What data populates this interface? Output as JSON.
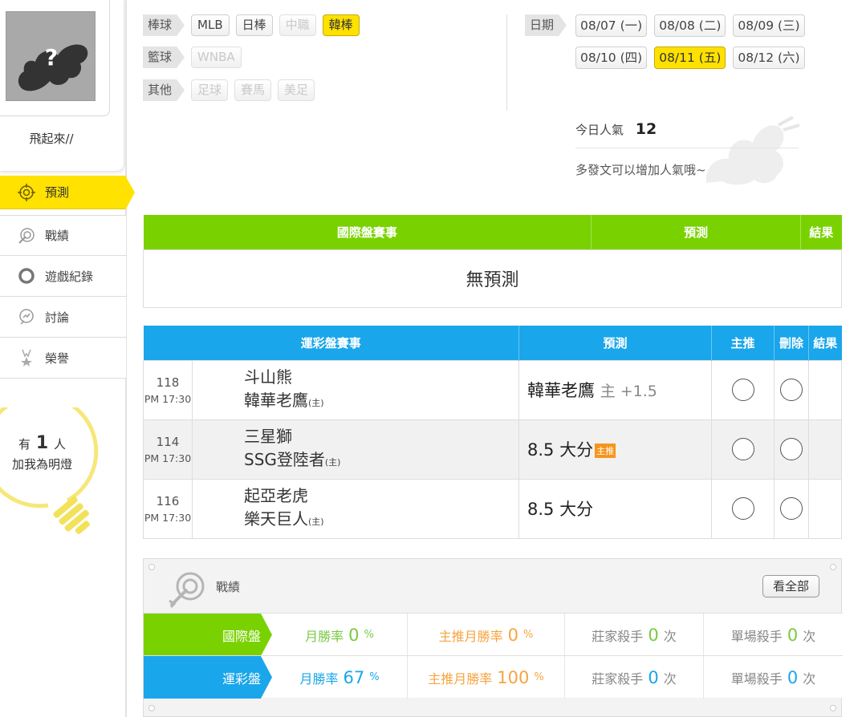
{
  "user": {
    "name": "飛起來//"
  },
  "nav": [
    {
      "label": "預測",
      "icon": "target-icon",
      "active": true
    },
    {
      "label": "戰績",
      "icon": "record-target-icon",
      "active": false
    },
    {
      "label": "遊戲紀錄",
      "icon": "ring-icon",
      "active": false
    },
    {
      "label": "討論",
      "icon": "discussion-icon",
      "active": false
    },
    {
      "label": "榮譽",
      "icon": "medal-icon",
      "active": false
    }
  ],
  "fans": {
    "prefix": "有",
    "count": "1",
    "suffix": "人",
    "line2": "加我為明燈"
  },
  "filters": {
    "baseball": {
      "label": "棒球",
      "items": [
        {
          "label": "MLB",
          "state": "normal"
        },
        {
          "label": "日棒",
          "state": "normal"
        },
        {
          "label": "中職",
          "state": "disabled"
        },
        {
          "label": "韓棒",
          "state": "selected"
        }
      ]
    },
    "basketball": {
      "label": "籃球",
      "items": [
        {
          "label": "WNBA",
          "state": "disabled"
        }
      ]
    },
    "other": {
      "label": "其他",
      "items": [
        {
          "label": "足球",
          "state": "disabled"
        },
        {
          "label": "賽馬",
          "state": "disabled"
        },
        {
          "label": "美足",
          "state": "disabled"
        }
      ]
    }
  },
  "dates": {
    "label": "日期",
    "row1": [
      {
        "label": "08/07 (一)",
        "selected": false
      },
      {
        "label": "08/08 (二)",
        "selected": false
      },
      {
        "label": "08/09 (三)",
        "selected": false
      }
    ],
    "row2": [
      {
        "label": "08/10 (四)",
        "selected": false
      },
      {
        "label": "08/11 (五)",
        "selected": true
      },
      {
        "label": "08/12 (六)",
        "selected": false
      }
    ]
  },
  "popularity": {
    "label": "今日人氣",
    "value": "12",
    "hint": "多發文可以增加人氣哦~"
  },
  "intl_table": {
    "headers": {
      "event": "國際盤賽事",
      "prediction": "預測",
      "result": "結果"
    },
    "empty": "無預測"
  },
  "lottery_table": {
    "headers": {
      "event": "運彩盤賽事",
      "prediction": "預測",
      "main": "主推",
      "delete": "刪除",
      "result": "結果"
    },
    "home_mark": "(主)",
    "rows": [
      {
        "no": "118",
        "time": "PM 17:30",
        "away": "斗山熊",
        "home": "韓華老鷹",
        "pick": "韓華老鷹",
        "pick_sub": "主 +1.5",
        "badge": ""
      },
      {
        "no": "114",
        "time": "PM 17:30",
        "away": "三星獅",
        "home": "SSG登陸者",
        "pick": "8.5 大分",
        "pick_sub": "",
        "badge": "主推"
      },
      {
        "no": "116",
        "time": "PM 17:30",
        "away": "起亞老虎",
        "home": "樂天巨人",
        "pick": "8.5 大分",
        "pick_sub": "",
        "badge": ""
      }
    ]
  },
  "record": {
    "title": "戰績",
    "view_all": "看全部",
    "rows": [
      {
        "label": "國際盤",
        "color": "#79d200",
        "month_label": "月勝率",
        "month_value": "0",
        "month_unit": "%",
        "main_label": "主推月勝率",
        "main_value": "0",
        "main_unit": "%",
        "banker_label": "莊家殺手",
        "banker_value": "0",
        "banker_unit": "次",
        "single_label": "單場殺手",
        "single_value": "0",
        "single_unit": "次"
      },
      {
        "label": "運彩盤",
        "color": "#1aa6ea",
        "month_label": "月勝率",
        "month_value": "67",
        "month_unit": "%",
        "main_label": "主推月勝率",
        "main_value": "100",
        "main_unit": "%",
        "banker_label": "莊家殺手",
        "banker_value": "0",
        "banker_unit": "次",
        "single_label": "單場殺手",
        "single_value": "0",
        "single_unit": "次"
      }
    ]
  },
  "colors": {
    "yellow": "#ffe100",
    "green": "#79d200",
    "blue": "#1aa6ea",
    "orange": "#f7941d",
    "green_text": "#7ac943",
    "orange_text": "#f7a440",
    "blue_text": "#1aa6ea"
  }
}
